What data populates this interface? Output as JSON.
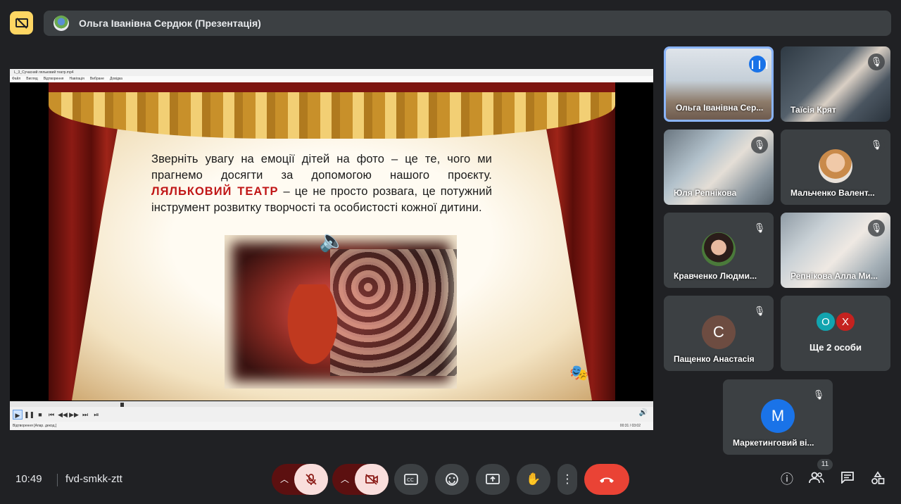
{
  "presenter": {
    "name": "Ольга Іванівна Сердюк (Презентація)"
  },
  "player": {
    "title": "L_3_Сучасний ляльковий театр.mp4",
    "menu": [
      "Файл",
      "Вигляд",
      "Відтворення",
      "Навігація",
      "Вибране",
      "Довідка"
    ],
    "status": "Відтворення [Апар. декод.]",
    "time": "00:31 / 03:02"
  },
  "slide": {
    "text_before": "Зверніть увагу на емоції дітей на фото – це те, чого ми прагнемо досягти за допомогою нашого проєкту.",
    "highlight": "ЛЯЛЬКОВИЙ ТЕАТР",
    "text_after": "– це не просто розвага, це потужний інструмент розвитку творчості та особистості кожної дитини."
  },
  "participants": [
    {
      "name": "Ольга Іванівна Сер...",
      "speaking": true
    },
    {
      "name": "Таїсія Крят"
    },
    {
      "name": "Юля Репнікова"
    },
    {
      "name": "Мальченко Валент..."
    },
    {
      "name": "Кравченко Людми..."
    },
    {
      "name": "Репнікова Алла Ми..."
    },
    {
      "name": "Пащенко Анастасія",
      "initial": "С",
      "color": "#6d4c41"
    },
    {
      "name": "Ще 2 особи",
      "initials": [
        "О",
        "Х"
      ],
      "colors": [
        "#12a4af",
        "#c5221f"
      ]
    },
    {
      "name": "Маркетинговий ві...",
      "initial": "М",
      "color": "#1a73e8"
    }
  ],
  "bottom": {
    "time": "10:49",
    "meeting_code": "fvd-smkk-ztt",
    "participant_count": "11"
  },
  "icons": {
    "mic_off": "mic-off-icon",
    "cam_off": "camera-off-icon",
    "captions": "captions-icon",
    "emoji": "emoji-icon",
    "present": "present-screen-icon",
    "hand": "raise-hand-icon",
    "more": "more-vert-icon",
    "hangup": "call-end-icon"
  }
}
